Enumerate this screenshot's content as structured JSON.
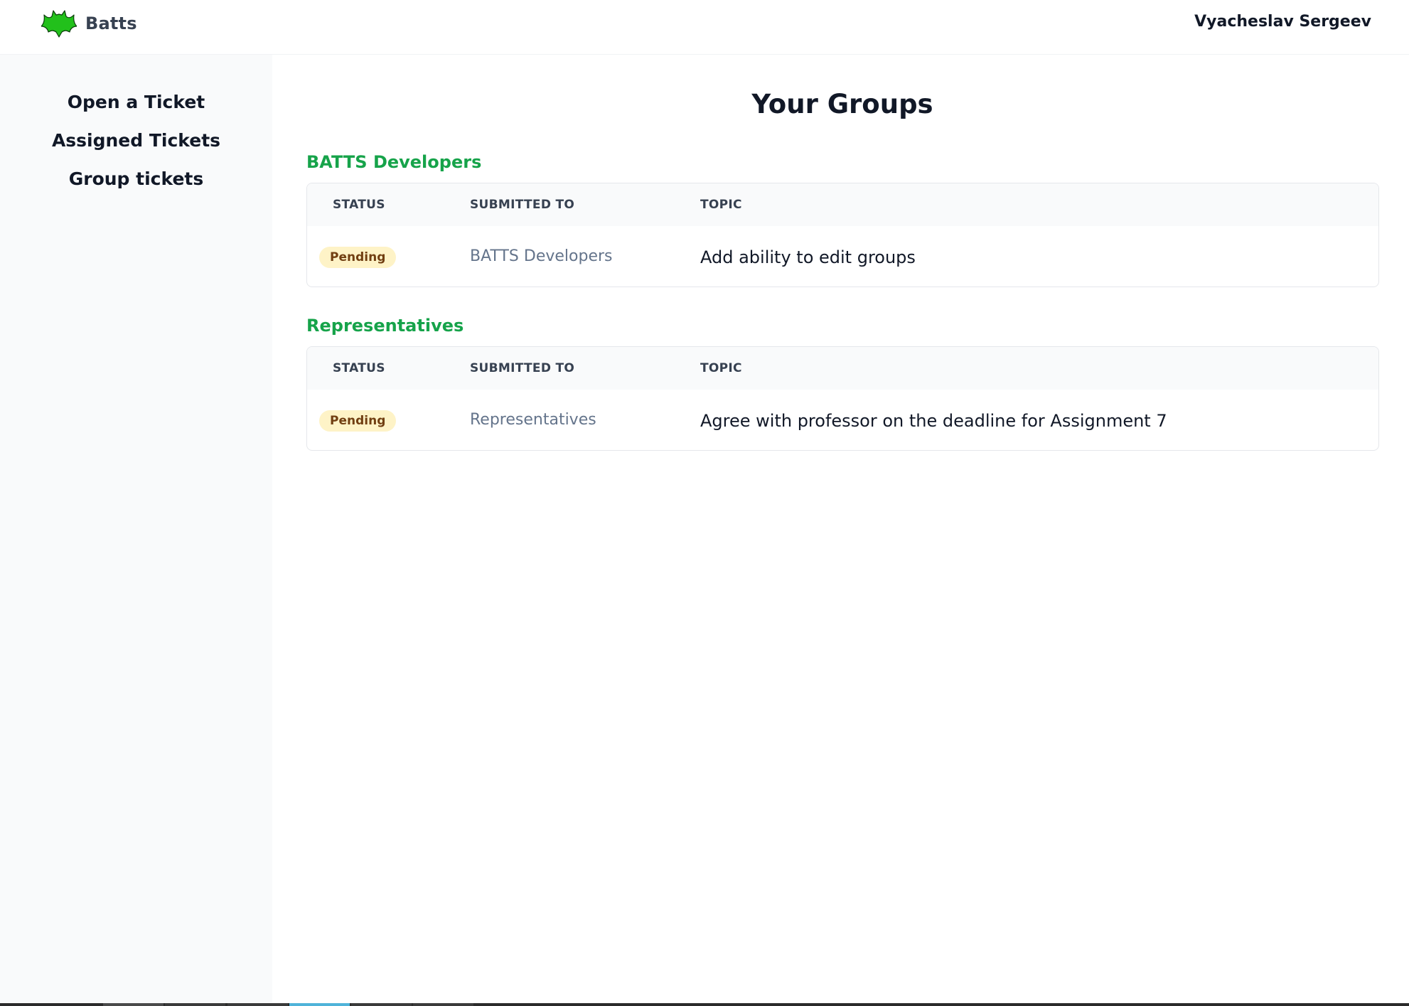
{
  "header": {
    "brand_name": "Batts",
    "user_name": "Vyacheslav Sergeev",
    "logo_icon": "bat-icon",
    "logo_color": "#22c01b"
  },
  "sidebar": {
    "items": [
      {
        "label": "Open a Ticket"
      },
      {
        "label": "Assigned Tickets"
      },
      {
        "label": "Group tickets"
      }
    ]
  },
  "main": {
    "title": "Your Groups",
    "groups": [
      {
        "name": "BATTS Developers",
        "columns": [
          "STATUS",
          "SUBMITTED TO",
          "TOPIC"
        ],
        "rows": [
          {
            "status": "Pending",
            "submitted_to": "BATTS Developers",
            "topic": "Add ability to edit groups"
          }
        ]
      },
      {
        "name": "Representatives",
        "columns": [
          "STATUS",
          "SUBMITTED TO",
          "TOPIC"
        ],
        "rows": [
          {
            "status": "Pending",
            "submitted_to": "Representatives",
            "topic": "Agree with professor on the deadline for Assignment 7"
          }
        ]
      }
    ]
  },
  "colors": {
    "accent_green": "#16a34a",
    "pending_badge_bg": "#fef3c7",
    "pending_badge_text": "#713f12",
    "sidebar_bg": "#f9fafb"
  }
}
